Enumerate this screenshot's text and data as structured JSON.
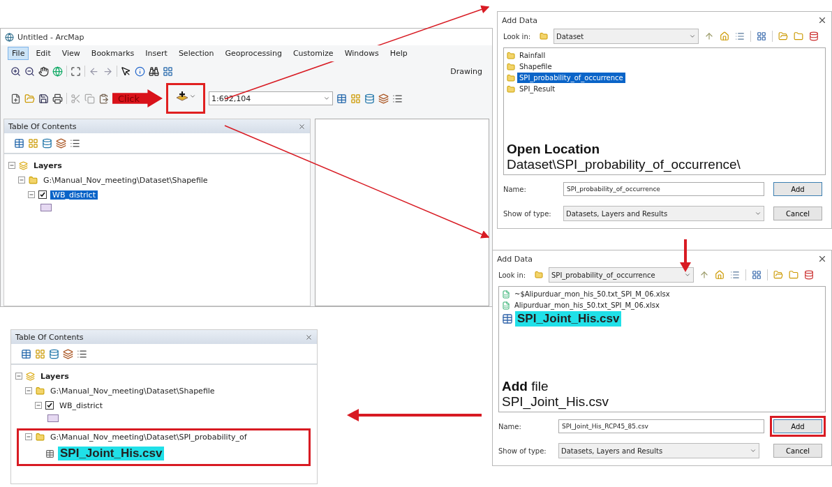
{
  "arcmap": {
    "title": "Untitled - ArcMap",
    "menu": [
      {
        "label": "File",
        "selected": true
      },
      {
        "label": "Edit",
        "selected": false
      },
      {
        "label": "View",
        "selected": false
      },
      {
        "label": "Bookmarks",
        "selected": false
      },
      {
        "label": "Insert",
        "selected": false
      },
      {
        "label": "Selection",
        "selected": false
      },
      {
        "label": "Geoprocessing",
        "selected": false
      },
      {
        "label": "Customize",
        "selected": false
      },
      {
        "label": "Windows",
        "selected": false
      },
      {
        "label": "Help",
        "selected": false
      }
    ],
    "toolbar_label": "Drawing",
    "callout": "Click",
    "add_data_outlined": true,
    "scale": "1:692,104",
    "toc": {
      "title": "Table Of Contents",
      "tree": [
        {
          "label": "Layers",
          "kind": "group",
          "expanded": true,
          "outlined": false,
          "children": [
            {
              "label": "G:\\Manual_Nov_meeting\\Dataset\\Shapefile",
              "kind": "folder",
              "expanded": true,
              "outlined": false,
              "children": [
                {
                  "label": "WB_district",
                  "kind": "layer",
                  "expanded": true,
                  "checked": true,
                  "selected": true,
                  "highlighted": false,
                  "outlined": false
                }
              ]
            }
          ]
        }
      ]
    }
  },
  "dialogs": [
    {
      "title": "Add Data",
      "look_in_label": "Look in:",
      "look_in": "Dataset",
      "items": [
        {
          "label": "Rainfall",
          "kind": "folder",
          "selected": false,
          "highlighted": false
        },
        {
          "label": "Shapefile",
          "kind": "folder",
          "selected": false,
          "highlighted": false
        },
        {
          "label": "SPI_probability_of_occurrence",
          "kind": "folder",
          "selected": true,
          "highlighted": false
        },
        {
          "label": "SPI_Result",
          "kind": "folder",
          "selected": false,
          "highlighted": false
        }
      ],
      "note": [
        {
          "text": "Open Location",
          "bold": true
        },
        {
          "text": "Dataset\\SPI_probability_of_occurrence\\",
          "bold": false
        }
      ],
      "name_label": "Name:",
      "name": "SPI_probability_of_occurrence",
      "type_label": "Show of type:",
      "type": "Datasets, Layers and Results",
      "buttons": [
        {
          "label": "Add",
          "outlined": false
        },
        {
          "label": "Cancel",
          "outlined": false
        }
      ]
    },
    {
      "title": "Add Data",
      "look_in_label": "Look in:",
      "look_in": "SPI_probability_of_occurrence",
      "items": [
        {
          "label": "~$Alipurduar_mon_his_50.txt_SPI_M_06.xlsx",
          "kind": "sheet",
          "selected": false,
          "highlighted": false
        },
        {
          "label": "Alipurduar_mon_his_50.txt_SPI_M_06.xlsx",
          "kind": "sheet",
          "selected": false,
          "highlighted": false
        },
        {
          "label": "SPI_Joint_His.csv",
          "kind": "table",
          "selected": false,
          "highlighted": true
        }
      ],
      "note": [
        {
          "text": "**Add** file",
          "bold": false
        },
        {
          "text": "SPI_Joint_His.csv",
          "bold": false
        }
      ],
      "name_label": "Name:",
      "name": "SPI_Joint_His_RCP45_85.csv",
      "type_label": "Show of type:",
      "type": "Datasets, Layers and Results",
      "buttons": [
        {
          "label": "Add",
          "outlined": true
        },
        {
          "label": "Cancel",
          "outlined": false
        }
      ]
    }
  ],
  "result_toc": {
    "title": "Table Of Contents",
    "tree": [
      {
        "label": "Layers",
        "kind": "group",
        "expanded": true,
        "outlined": false,
        "children": [
          {
            "label": "G:\\Manual_Nov_meeting\\Dataset\\Shapefile",
            "kind": "folder",
            "expanded": true,
            "outlined": false,
            "children": [
              {
                "label": "WB_district",
                "kind": "layer",
                "expanded": true,
                "checked": true,
                "selected": false,
                "highlighted": false,
                "outlined": false
              }
            ]
          },
          {
            "label": "G:\\Manual_Nov_meeting\\Dataset\\SPI_probability_of",
            "kind": "folder",
            "expanded": true,
            "outlined": true,
            "children": [
              {
                "label": "SPI_Joint_His.csv",
                "kind": "table",
                "highlighted": true,
                "selected": false,
                "outlined": false
              }
            ]
          }
        ]
      }
    ]
  }
}
